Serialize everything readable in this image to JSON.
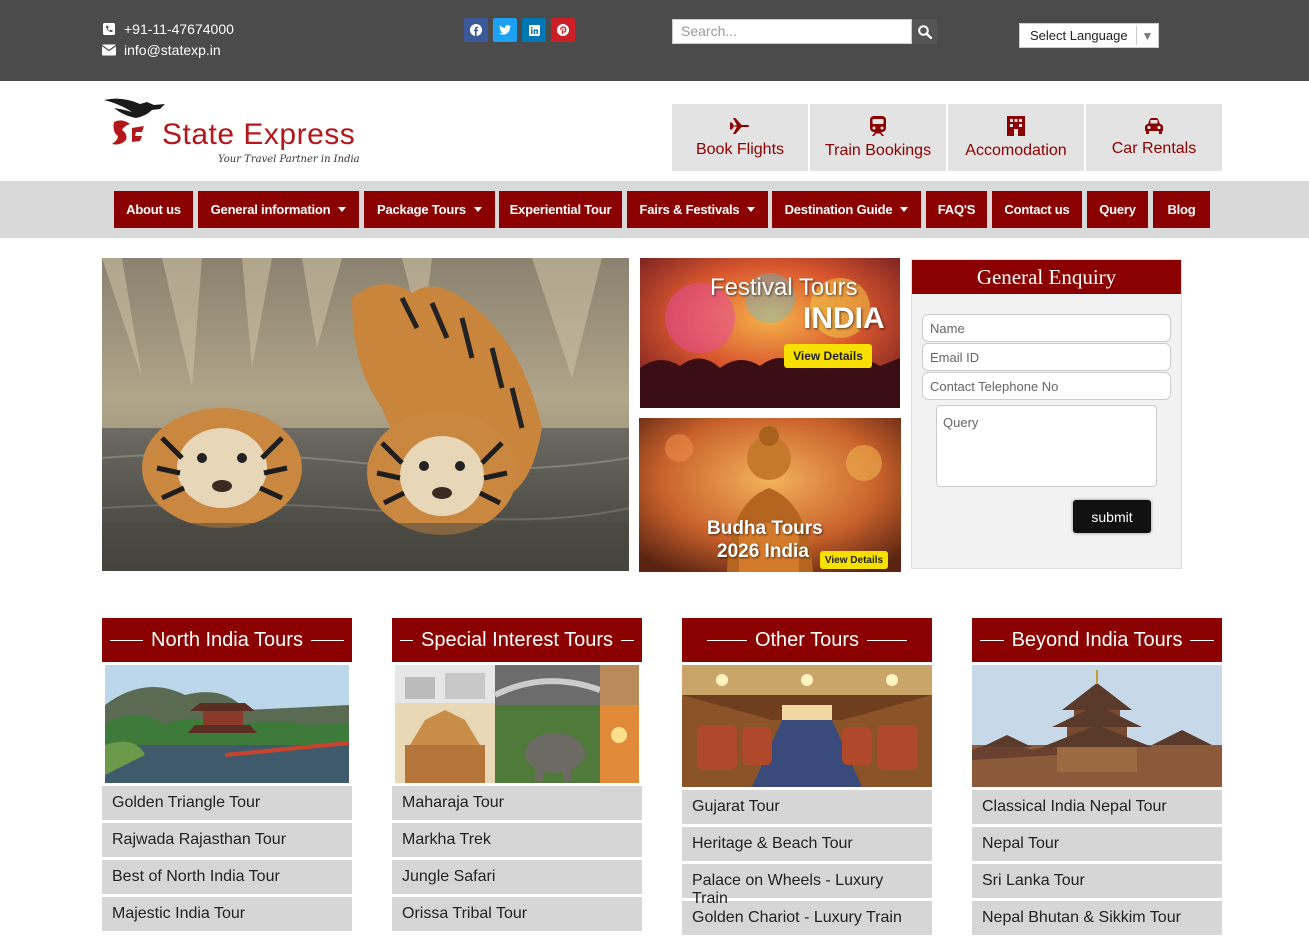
{
  "topbar": {
    "phone": "+91-11-47674000",
    "email": "info@statexp.in",
    "social": [
      "facebook-icon",
      "twitter-icon",
      "linkedin-icon",
      "pinterest-icon"
    ],
    "search_placeholder": "Search...",
    "language": "Select Language"
  },
  "header": {
    "brand": "State Express",
    "tagline": "Your Travel Partner in India",
    "services": [
      {
        "label": "Book Flights",
        "icon": "plane-icon"
      },
      {
        "label": "Train Bookings",
        "icon": "train-icon"
      },
      {
        "label": "Accomodation",
        "icon": "hotel-icon"
      },
      {
        "label": "Car Rentals",
        "icon": "car-icon"
      }
    ]
  },
  "nav": [
    {
      "label": "About us"
    },
    {
      "label": "General information",
      "dropdown": true
    },
    {
      "label": "Package Tours",
      "dropdown": true
    },
    {
      "label": "Experiential Tour"
    },
    {
      "label": "Fairs & Festivals",
      "dropdown": true
    },
    {
      "label": "Destination Guide",
      "dropdown": true
    },
    {
      "label": "FAQ'S"
    },
    {
      "label": "Contact us"
    },
    {
      "label": "Query"
    },
    {
      "label": "Blog"
    }
  ],
  "promos": {
    "festival": {
      "line1": "Festival Tours",
      "line2": "INDIA",
      "cta": "View Details"
    },
    "budha": {
      "line1": "Budha Tours",
      "line2": "2026 India",
      "cta": "View Details"
    }
  },
  "enquiry": {
    "title": "General Enquiry",
    "name_placeholder": "Name",
    "email_placeholder": "Email ID",
    "phone_placeholder": "Contact Telephone No",
    "query_placeholder": "Query",
    "submit": "submit"
  },
  "columns": [
    {
      "title": "North India Tours",
      "tours": [
        "Golden Triangle Tour",
        "Rajwada Rajasthan Tour",
        "Best of North India Tour",
        "Majestic India Tour"
      ]
    },
    {
      "title": "Special Interest Tours",
      "tours": [
        "Maharaja Tour",
        "Markha Trek",
        "Jungle Safari",
        "Orissa Tribal Tour"
      ]
    },
    {
      "title": "Other Tours",
      "tours": [
        "Gujarat Tour",
        "Heritage & Beach Tour",
        "Palace on Wheels - Luxury Train",
        "Golden Chariot - Luxury Train"
      ]
    },
    {
      "title": "Beyond India Tours",
      "tours": [
        "Classical India Nepal Tour",
        "Nepal Tour",
        "Sri Lanka Tour",
        "Nepal Bhutan & Sikkim Tour"
      ]
    }
  ],
  "colors": {
    "brand": "#8b0000",
    "topbar": "#4b4b4b",
    "nav_bg": "#d9d9d9"
  }
}
